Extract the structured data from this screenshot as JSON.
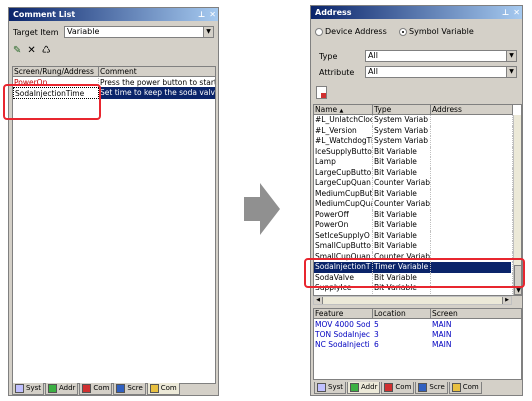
{
  "left_panel": {
    "title": "Comment List",
    "title_icons": [
      "pin-icon",
      "close-icon"
    ],
    "target_item_label": "Target Item",
    "target_item_value": "Variable",
    "toolbar": [
      "edit-icon",
      "delete-icon",
      "clear-icon"
    ],
    "columns": [
      "Screen/Rung/Address",
      "Comment"
    ],
    "rows": [
      {
        "address": "PowerOn",
        "comment": "Press the power button to start"
      },
      {
        "address": "SodaInjectionTime",
        "comment": "Set time to keep the soda valve"
      }
    ],
    "tabs": [
      "Syst",
      "Addr",
      "Com",
      "Scre",
      "Com"
    ]
  },
  "right_panel": {
    "title": "Address",
    "title_icons": [
      "pin-icon",
      "close-icon"
    ],
    "radio_device": "Device Address",
    "radio_symbol": "Symbol Variable",
    "type_label": "Type",
    "type_value": "All",
    "attribute_label": "Attribute",
    "attribute_value": "All",
    "columns": [
      "Name",
      "Type",
      "Address"
    ],
    "rows": [
      {
        "name": "#L_UnlatchCloc",
        "type": "System Variab"
      },
      {
        "name": "#L_Version",
        "type": "System Variab"
      },
      {
        "name": "#L_WatchdogTi",
        "type": "System Variab"
      },
      {
        "name": "IceSupplyButto",
        "type": "Bit Variable"
      },
      {
        "name": "Lamp",
        "type": "Bit Variable"
      },
      {
        "name": "LargeCupButto",
        "type": "Bit Variable"
      },
      {
        "name": "LargeCupQuan",
        "type": "Counter Variab"
      },
      {
        "name": "MediumCupBut",
        "type": "Bit Variable"
      },
      {
        "name": "MediumCupQua",
        "type": "Counter Variab"
      },
      {
        "name": "PowerOff",
        "type": "Bit Variable"
      },
      {
        "name": "PowerOn",
        "type": "Bit Variable"
      },
      {
        "name": "SetIceSupplyO",
        "type": "Bit Variable"
      },
      {
        "name": "SmallCupButto",
        "type": "Bit Variable"
      },
      {
        "name": "SmallCupQuan",
        "type": "Counter Variab"
      },
      {
        "name": "SodaInjectionT",
        "type": "Timer Variable"
      },
      {
        "name": "SodaValve",
        "type": "Bit Variable"
      },
      {
        "name": "SupplyIce",
        "type": "Bit Variable"
      }
    ],
    "feature_columns": [
      "Feature",
      "Location",
      "Screen"
    ],
    "feature_rows": [
      {
        "feature": "MOV 4000 Sod",
        "location": "5",
        "screen": "MAIN"
      },
      {
        "feature": "TON SodaInjec",
        "location": "3",
        "screen": "MAIN"
      },
      {
        "feature": "NC SodaInjecti",
        "location": "6",
        "screen": "MAIN"
      }
    ],
    "tabs": [
      "Syst",
      "Addr",
      "Com",
      "Scre",
      "Com"
    ]
  },
  "colors": {
    "selection": "#0a246a",
    "highlight_box": "#e8262f",
    "arrow": "#909090",
    "link_text": "#0000c0"
  }
}
